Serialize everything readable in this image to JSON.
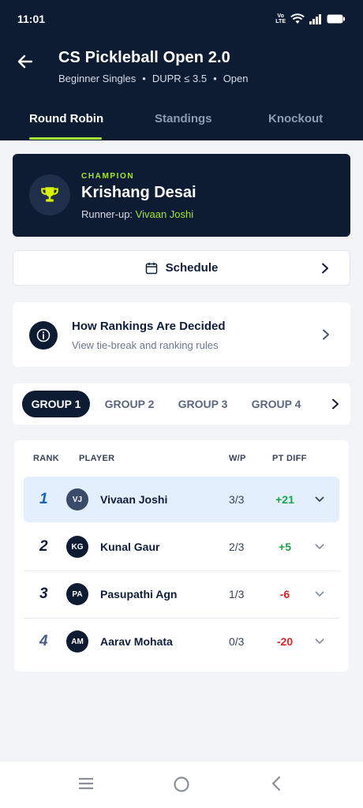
{
  "status_bar": {
    "time": "11:01",
    "network_label": "LTE"
  },
  "header": {
    "title": "CS Pickleball Open 2.0",
    "subtitle": {
      "category": "Beginner Singles",
      "rating": "DUPR ≤ 3.5",
      "status": "Open",
      "separator": "•"
    },
    "tabs": [
      {
        "label": "Round Robin",
        "active": true
      },
      {
        "label": "Standings",
        "active": false
      },
      {
        "label": "Knockout",
        "active": false
      }
    ]
  },
  "champion": {
    "label": "CHAMPION",
    "name": "Krishang Desai",
    "runner_up_label": "Runner-up:",
    "runner_up_name": "Vivaan Joshi"
  },
  "schedule": {
    "label": "Schedule"
  },
  "rankings_info": {
    "title": "How Rankings Are Decided",
    "subtitle": "View tie-break and ranking rules"
  },
  "groups": [
    {
      "label": "GROUP 1",
      "active": true
    },
    {
      "label": "GROUP 2",
      "active": false
    },
    {
      "label": "GROUP 3",
      "active": false
    },
    {
      "label": "GROUP 4",
      "active": false
    }
  ],
  "standings": {
    "columns": {
      "rank": "RANK",
      "player": "PLAYER",
      "wp": "W/P",
      "diff": "PT DIFF"
    },
    "rows": [
      {
        "rank": "1",
        "initials": "VJ",
        "name": "Vivaan Joshi",
        "wp": "3/3",
        "diff": "+21",
        "diff_sign": "positive",
        "highlighted": true
      },
      {
        "rank": "2",
        "initials": "KG",
        "name": "Kunal Gaur",
        "wp": "2/3",
        "diff": "+5",
        "diff_sign": "positive",
        "highlighted": false
      },
      {
        "rank": "3",
        "initials": "PA",
        "name": "Pasupathi Agn",
        "wp": "1/3",
        "diff": "-6",
        "diff_sign": "negative",
        "highlighted": false
      },
      {
        "rank": "4",
        "initials": "AM",
        "name": "Aarav Mohata",
        "wp": "0/3",
        "diff": "-20",
        "diff_sign": "negative",
        "highlighted": false
      }
    ]
  },
  "colors": {
    "navy": "#0d1b33",
    "accent_lime": "#a3e635",
    "positive": "#1fa34a",
    "negative": "#dc2626",
    "highlight_row": "#e3effc",
    "rank_highlight": "#1e5fb8",
    "rank_last": "#4a5a80"
  },
  "icons": {
    "back": "arrow-left-icon",
    "trophy": "trophy-icon",
    "calendar": "calendar-icon",
    "info": "info-icon",
    "chevron": "chevron-right-icon",
    "expand": "chevron-down-icon",
    "nav": [
      "menu-icon",
      "home-circle-icon",
      "back-chevron-icon"
    ]
  }
}
